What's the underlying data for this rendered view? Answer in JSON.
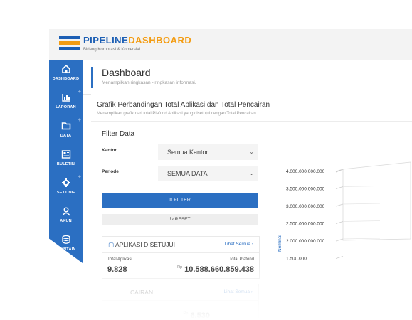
{
  "brand": {
    "title_part1": "PIPELINE",
    "title_part2": "DASHBOARD",
    "subtitle": "Bidang Korporasi & Komersial",
    "colors": {
      "blue": "#1d5fb4",
      "orange": "#f39c12",
      "sidebar": "#2b6fc2"
    }
  },
  "sidebar": {
    "items": [
      {
        "label": "DASHBOARD",
        "icon": "home-icon",
        "has_submenu": false
      },
      {
        "label": "LAPORAN",
        "icon": "bar-chart-icon",
        "has_submenu": true
      },
      {
        "label": "DATA",
        "icon": "folder-icon",
        "has_submenu": true
      },
      {
        "label": "BULETIN",
        "icon": "newspaper-icon",
        "has_submenu": false
      },
      {
        "label": "SETTING",
        "icon": "gear-icon",
        "has_submenu": true
      },
      {
        "label": "AKUN",
        "icon": "user-icon",
        "has_submenu": false
      },
      {
        "label": "MAINTAIN",
        "icon": "database-icon",
        "has_submenu": false
      }
    ]
  },
  "header": {
    "title": "Dashboard",
    "description": "Menampilkan ringkasan - ringkasan informasi."
  },
  "section": {
    "title": "Grafik Perbandingan Total Aplikasi dan Total Pencairan",
    "description": "Menampilkan grafik dari total Plafond Aplikasi yang disetujui dengan Total Pencairan."
  },
  "filter": {
    "title": "Filter Data",
    "kantor_label": "Kantor",
    "kantor_value": "Semua Kantor",
    "periode_label": "Periode",
    "periode_value": "SEMUA DATA",
    "filter_button": "FILTER",
    "reset_button": "RESET"
  },
  "cards": [
    {
      "title": "APLIKASI DISETUJUI",
      "link": "Lihat Semua",
      "label_left": "Total Aplikasi",
      "label_right": "Total Plafond",
      "value_left": "9.828",
      "currency": "Rp",
      "value_right": "10.588.660.859.438"
    },
    {
      "title": "CAIRAN",
      "link": "Lihat Semua",
      "currency": "Rp",
      "value_right": "6.530"
    }
  ],
  "chart_data": {
    "type": "bar",
    "ylabel": "Nominal",
    "y_ticks": [
      "4.000.000.000.000",
      "3.500.000.000.000",
      "3.000.000.000.000",
      "2.500.000.000.000",
      "2.000.000.000.000",
      "1.500.000"
    ],
    "categories": [],
    "series": []
  }
}
